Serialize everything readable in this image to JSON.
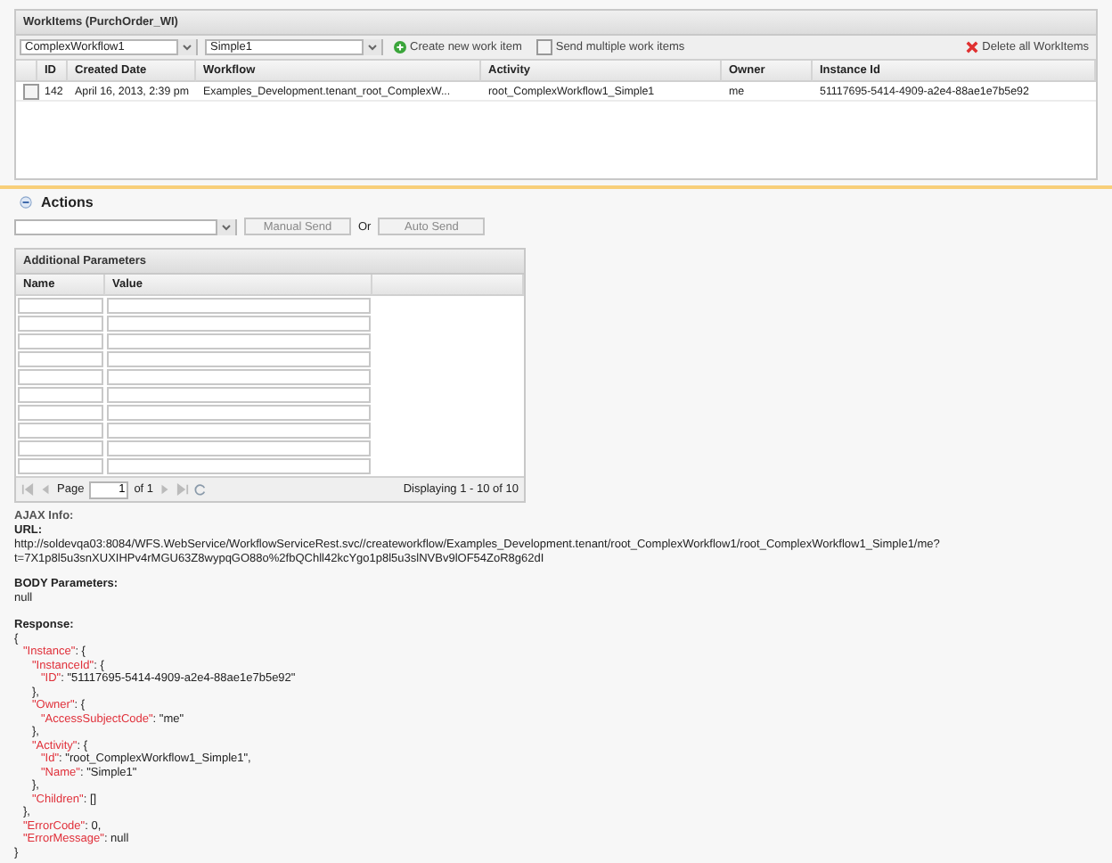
{
  "workitems": {
    "title": "WorkItems (PurchOrder_WI)",
    "workflow_select": "ComplexWorkflow1",
    "activity_select": "Simple1",
    "create_button": "Create new work item",
    "send_multiple": {
      "label": "Send multiple work items",
      "checked": false
    },
    "delete_button": "Delete all WorkItems",
    "columns": [
      "ID",
      "Created Date",
      "Workflow",
      "Activity",
      "Owner",
      "Instance Id"
    ],
    "rows": [
      {
        "checked": false,
        "cells": [
          "142",
          "April 16, 2013, 2:39 pm",
          "Examples_Development.tenant_root_ComplexW...",
          "root_ComplexWorkflow1_Simple1",
          "me",
          "51117695-5414-4909-a2e4-88ae1e7b5e92"
        ]
      }
    ]
  },
  "actions": {
    "title": "Actions",
    "expanded": true,
    "manual_send": "Manual Send",
    "or": "Or",
    "auto_send": "Auto Send"
  },
  "parameters": {
    "title": "Additional Parameters",
    "columns": [
      "Name",
      "Value"
    ],
    "rows": [
      {
        "kind": "input"
      },
      {
        "kind": "input"
      },
      {
        "kind": "input"
      },
      {
        "kind": "input"
      },
      {
        "kind": "input"
      },
      {
        "kind": "input"
      },
      {
        "kind": "input"
      },
      {
        "kind": "input"
      },
      {
        "kind": "input"
      },
      {
        "kind": "input"
      }
    ],
    "pager": {
      "page_label": "Page",
      "page": "1",
      "of": "of 1",
      "display": "Displaying 1 - 10 of 10"
    }
  },
  "ajax": {
    "label": "AJAX Info:",
    "url_label": "URL:",
    "url_lines": [
      "http://soldevqa03:8084/WFS.WebService/WorkflowServiceRest.svc//createworkflow/Examples_Development.tenant/root_ComplexWorkflow1/root_ComplexWorkflow1_Simple1/me?",
      "t=7X1p8l5u3snXUXIHPv4rMGU63Z8wypqGO88o%2fbQChll42kcYgo1p8l5u3slNVBv9lOF54ZoR8g62dI"
    ],
    "body_label": "BODY Parameters:",
    "body_value": "null",
    "response_label": "Response:",
    "response": {
      "text": "{",
      "close": "}",
      "children": [
        {
          "key": "\"Instance\"",
          "text": ": {",
          "close": "},",
          "children": [
            {
              "key": "\"InstanceId\"",
              "text": ": {",
              "close": "},",
              "children": [
                {
                  "key": "\"ID\"",
                  "text": ": \"51117695-5414-4909-a2e4-88ae1e7b5e92\""
                }
              ]
            },
            {
              "key": "\"Owner\"",
              "text": ": {",
              "close": "},",
              "children": [
                {
                  "key": "\"AccessSubjectCode\"",
                  "text": ": \"me\""
                }
              ]
            },
            {
              "key": "\"Activity\"",
              "text": ": {",
              "close": "},",
              "children": [
                {
                  "key": "\"Id\"",
                  "text": ": \"root_ComplexWorkflow1_Simple1\","
                },
                {
                  "key": "\"Name\"",
                  "text": ": \"Simple1\""
                }
              ]
            },
            {
              "key": "\"Children\"",
              "text": ": []"
            }
          ]
        },
        {
          "key": "\"ErrorCode\"",
          "text": ": 0,"
        },
        {
          "key": "\"ErrorMessage\"",
          "text": ": null"
        }
      ]
    }
  }
}
